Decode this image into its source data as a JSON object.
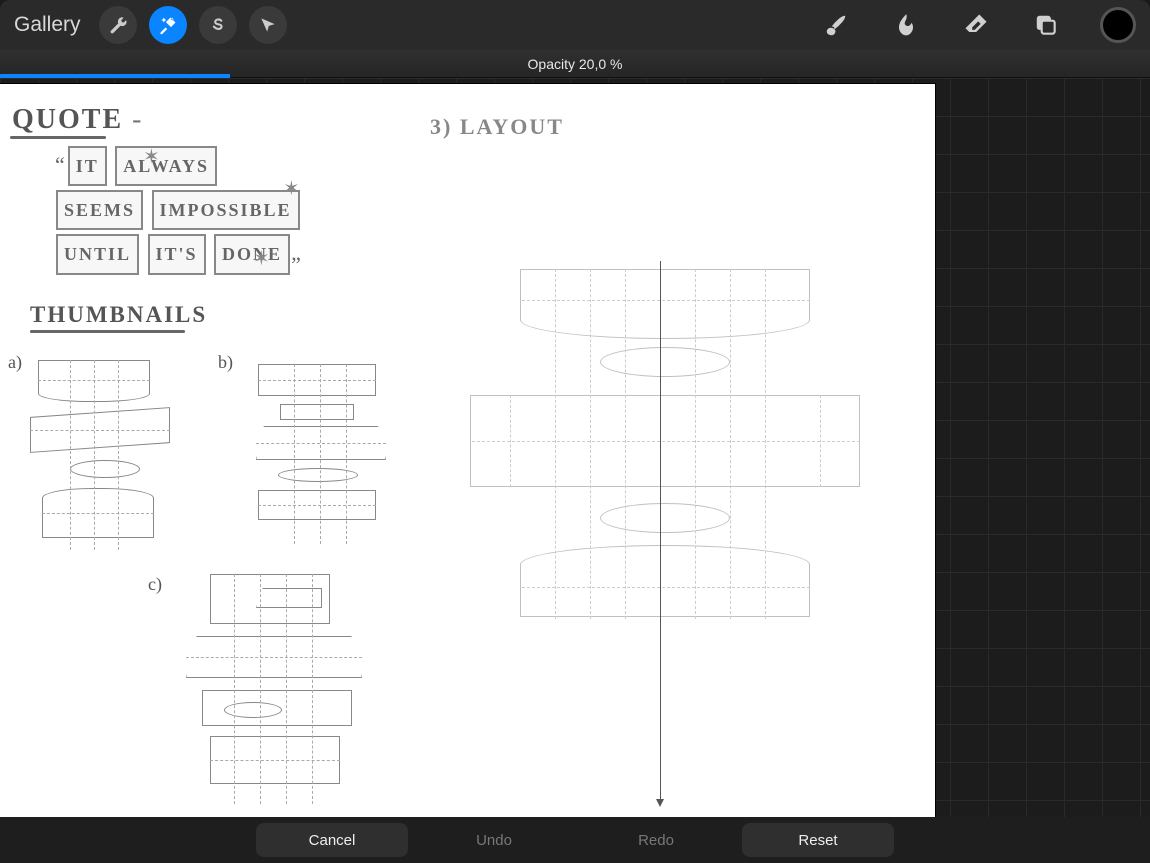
{
  "toolbar": {
    "gallery_label": "Gallery",
    "tools_left": [
      {
        "name": "wrench-icon"
      },
      {
        "name": "magic-wand-icon",
        "active": true
      },
      {
        "name": "s-tool-icon"
      },
      {
        "name": "cursor-icon"
      }
    ],
    "tools_right": [
      {
        "name": "brush-icon"
      },
      {
        "name": "smudge-icon"
      },
      {
        "name": "eraser-icon"
      },
      {
        "name": "layers-icon"
      },
      {
        "name": "color-swatch"
      }
    ]
  },
  "slider": {
    "label": "Opacity 20,0 %",
    "value_percent": 20.0
  },
  "canvas_content": {
    "quote_heading": "QUOTE",
    "quote_words": [
      "IT",
      "ALWAYS",
      "SEEMS",
      "IMPOSSIBLE",
      "UNTIL",
      "IT'S",
      "DONE"
    ],
    "thumbnails_heading": "THUMBNAILS",
    "thumbnail_labels": [
      "a)",
      "b)",
      "c)"
    ],
    "layout_heading": "3) LAYOUT"
  },
  "transform_bar": {
    "cancel": "Cancel",
    "undo": "Undo",
    "redo": "Redo",
    "reset": "Reset"
  }
}
